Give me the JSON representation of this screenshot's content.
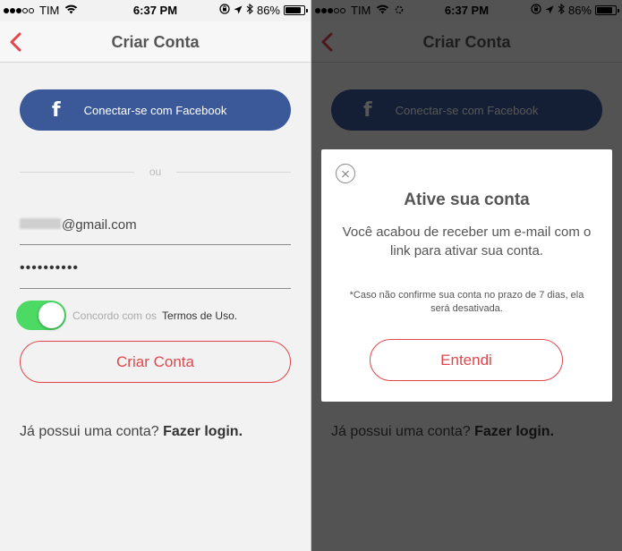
{
  "status_bar": {
    "carrier": "TIM",
    "time": "6:37 PM",
    "battery": "86%",
    "battery_level": 0.86
  },
  "nav": {
    "title": "Criar Conta",
    "back_icon": "chevron-left-icon"
  },
  "signup": {
    "facebook_label": "Conectar-se com Facebook",
    "or_label": "ou",
    "email_value": "@gmail.com",
    "password_value": "••••••••••",
    "agree_text": "Concordo com os",
    "terms_label": "Termos de Uso.",
    "create_button": "Criar Conta",
    "login_prompt": "Já possui uma conta?",
    "login_link": "Fazer login."
  },
  "modal": {
    "title": "Ative sua conta",
    "body": "Você acabou de receber um e-mail com o link para ativar sua conta.",
    "note": "*Caso não confirme sua conta no prazo de 7 dias, ela será desativada.",
    "button": "Entendi"
  },
  "colors": {
    "accent": "#e0474c",
    "facebook": "#3b5998",
    "toggle_on": "#4cd964"
  }
}
